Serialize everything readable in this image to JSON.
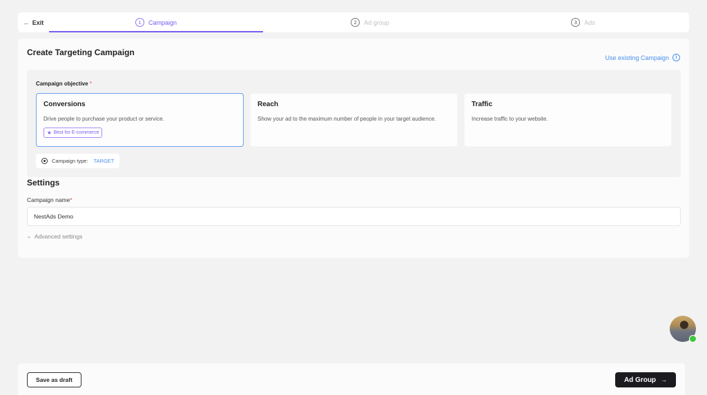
{
  "stepper": {
    "exit_label": "Exit",
    "exit_icon": "arrow-left-icon",
    "steps": [
      {
        "number": "1",
        "label": "Campaign",
        "active": true
      },
      {
        "number": "2",
        "label": "Ad group",
        "active": false
      },
      {
        "number": "3",
        "label": "Ads",
        "active": false
      }
    ]
  },
  "main": {
    "title": "Create Targeting Campaign",
    "use_existing_label": "Use existing Campaign",
    "use_existing_icon": "info-icon",
    "objective": {
      "label": "Campaign objective",
      "required_mark": "*",
      "options": [
        {
          "title": "Conversions",
          "description": "Drive people to purchase your product or service.",
          "badge": "Best for E-commerce",
          "badge_icon": "star-icon",
          "selected": true
        },
        {
          "title": "Reach",
          "description": "Show your ad to the maximum number of people in your target audience.",
          "selected": false
        },
        {
          "title": "Traffic",
          "description": "Increase traffic to your website.",
          "selected": false
        }
      ],
      "campaign_type_label": "Campaign type:",
      "campaign_type_value": "TARGET",
      "campaign_type_icon": "target-icon"
    },
    "settings": {
      "title": "Settings",
      "campaign_name_label": "Campaign name",
      "required_mark": "*",
      "campaign_name_value": "NestAds Demo",
      "advanced_label": "Advanced settings",
      "advanced_icon": "chevron-down-icon"
    }
  },
  "footer": {
    "save_draft_label": "Save as draft",
    "next_label": "Ad Group",
    "next_icon": "arrow-right-icon"
  },
  "colors": {
    "accent": "#7a5cf0",
    "link": "#4a8ff0",
    "selected_border": "#6ea1ec",
    "primary_button": "#1b1b1f",
    "online": "#3cc93c"
  }
}
